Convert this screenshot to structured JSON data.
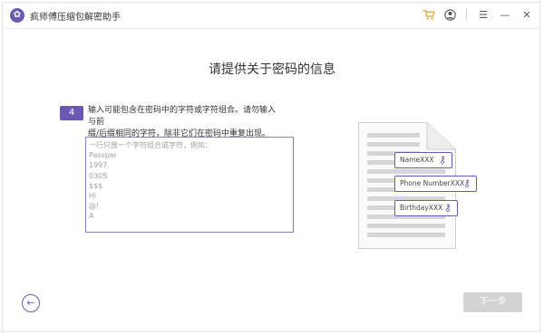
{
  "app": {
    "title": "疯师傅压缩包解密助手"
  },
  "header": {
    "headline": "请提供关于密码的信息"
  },
  "step": {
    "number": "4",
    "instruction_line1": "输入可能包含在密码中的字符或字符组合。请勿输入与前",
    "instruction_line2": "缀/后缀相同的字符，除非它们在密码中重复出现。"
  },
  "input": {
    "placeholder": "一行只放一个字符组合或字符，例如：",
    "examples": [
      "Passper",
      "1997",
      "0305",
      "$$$",
      "Hi",
      "@!",
      "A"
    ]
  },
  "illustration": {
    "tags": [
      "NameXXX",
      "Phone NumberXXX",
      "BirthdayXXX"
    ]
  },
  "nav": {
    "back_icon": "arrow-left-icon",
    "next_label": "下一步"
  },
  "colors": {
    "accent": "#6b58b5",
    "disabled": "#d3d3d3"
  }
}
